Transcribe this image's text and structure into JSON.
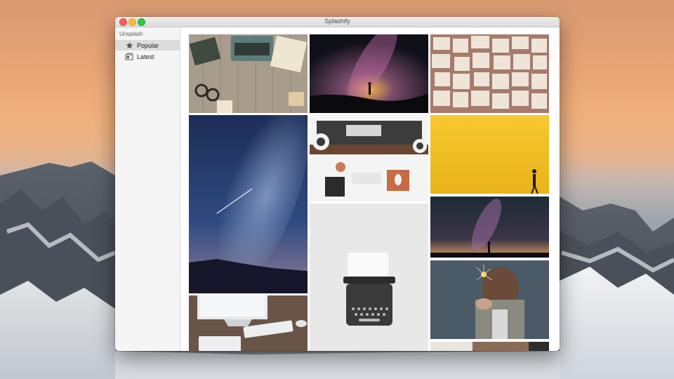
{
  "window": {
    "title": "Splashify"
  },
  "sidebar": {
    "section_title": "Unsplash",
    "items": [
      {
        "label": "Popular",
        "icon": "star-icon",
        "active": true
      },
      {
        "label": "Latest",
        "icon": "latest-icon",
        "active": false
      }
    ]
  },
  "colors": {
    "accent": "#dcdcdc",
    "close": "#fc605c",
    "minimize": "#fdbc40",
    "maximize": "#34c84a"
  }
}
